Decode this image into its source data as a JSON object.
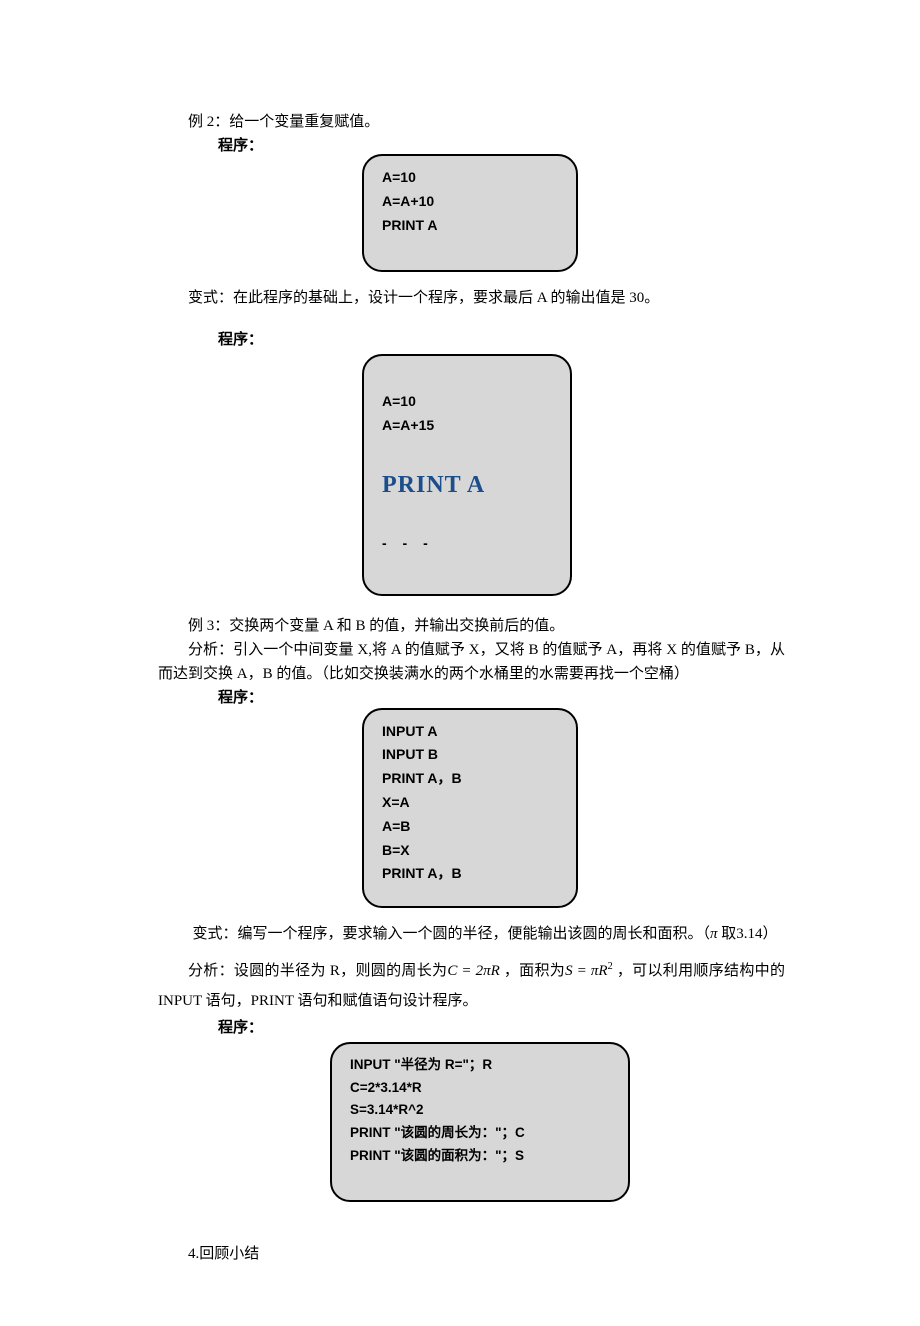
{
  "ex2": {
    "title": "例 2：给一个变量重复赋值。",
    "label": "程序：",
    "code": "A=10\nA=A+10\nPRINT  A"
  },
  "var1": {
    "title": "变式：在此程序的基础上，设计一个程序，要求最后 A 的输出值是 30。",
    "label": "程序：",
    "code_top": "A=10\nA=A+15",
    "code_print": "PRINT A",
    "dashes": "- - -"
  },
  "ex3": {
    "title": "例 3：交换两个变量 A 和 B 的值，并输出交换前后的值。",
    "analysis": "分析：引入一个中间变量 X,将 A 的值赋予 X，又将 B 的值赋予 A，再将 X 的值赋予 B，从而达到交换 A，B 的值。（比如交换装满水的两个水桶里的水需要再找一个空桶）",
    "label": "程序：",
    "code": "INPUT  A\nINPUT  B\nPRINT  A，B\nX=A\nA=B\nB=X\nPRINT  A，B"
  },
  "var2": {
    "title_prefix": "变式：编写一个程序，要求输入一个圆的半径，便能输出该圆的周长和面积。（",
    "pi_symbol": "π",
    "title_suffix": " 取3.14）",
    "analysis_prefix": "分析：设圆的半径为 R，则圆的周长为",
    "formula1": "C = 2πR",
    "analysis_mid": " ，面积为",
    "formula2_a": "S = πR",
    "formula2_sup": "2",
    "analysis_suffix": " ，可以利用顺序结构中的 INPUT 语句，PRINT 语句和赋值语句设计程序。",
    "label": "程序：",
    "code": "INPUT  \"半径为 R=\"；R\nC=2*3.14*R\nS=3.14*R^2\nPRINT  \"该圆的周长为：\"；C\nPRINT  \"该圆的面积为：\"；S"
  },
  "summary": "4.回顾小结"
}
